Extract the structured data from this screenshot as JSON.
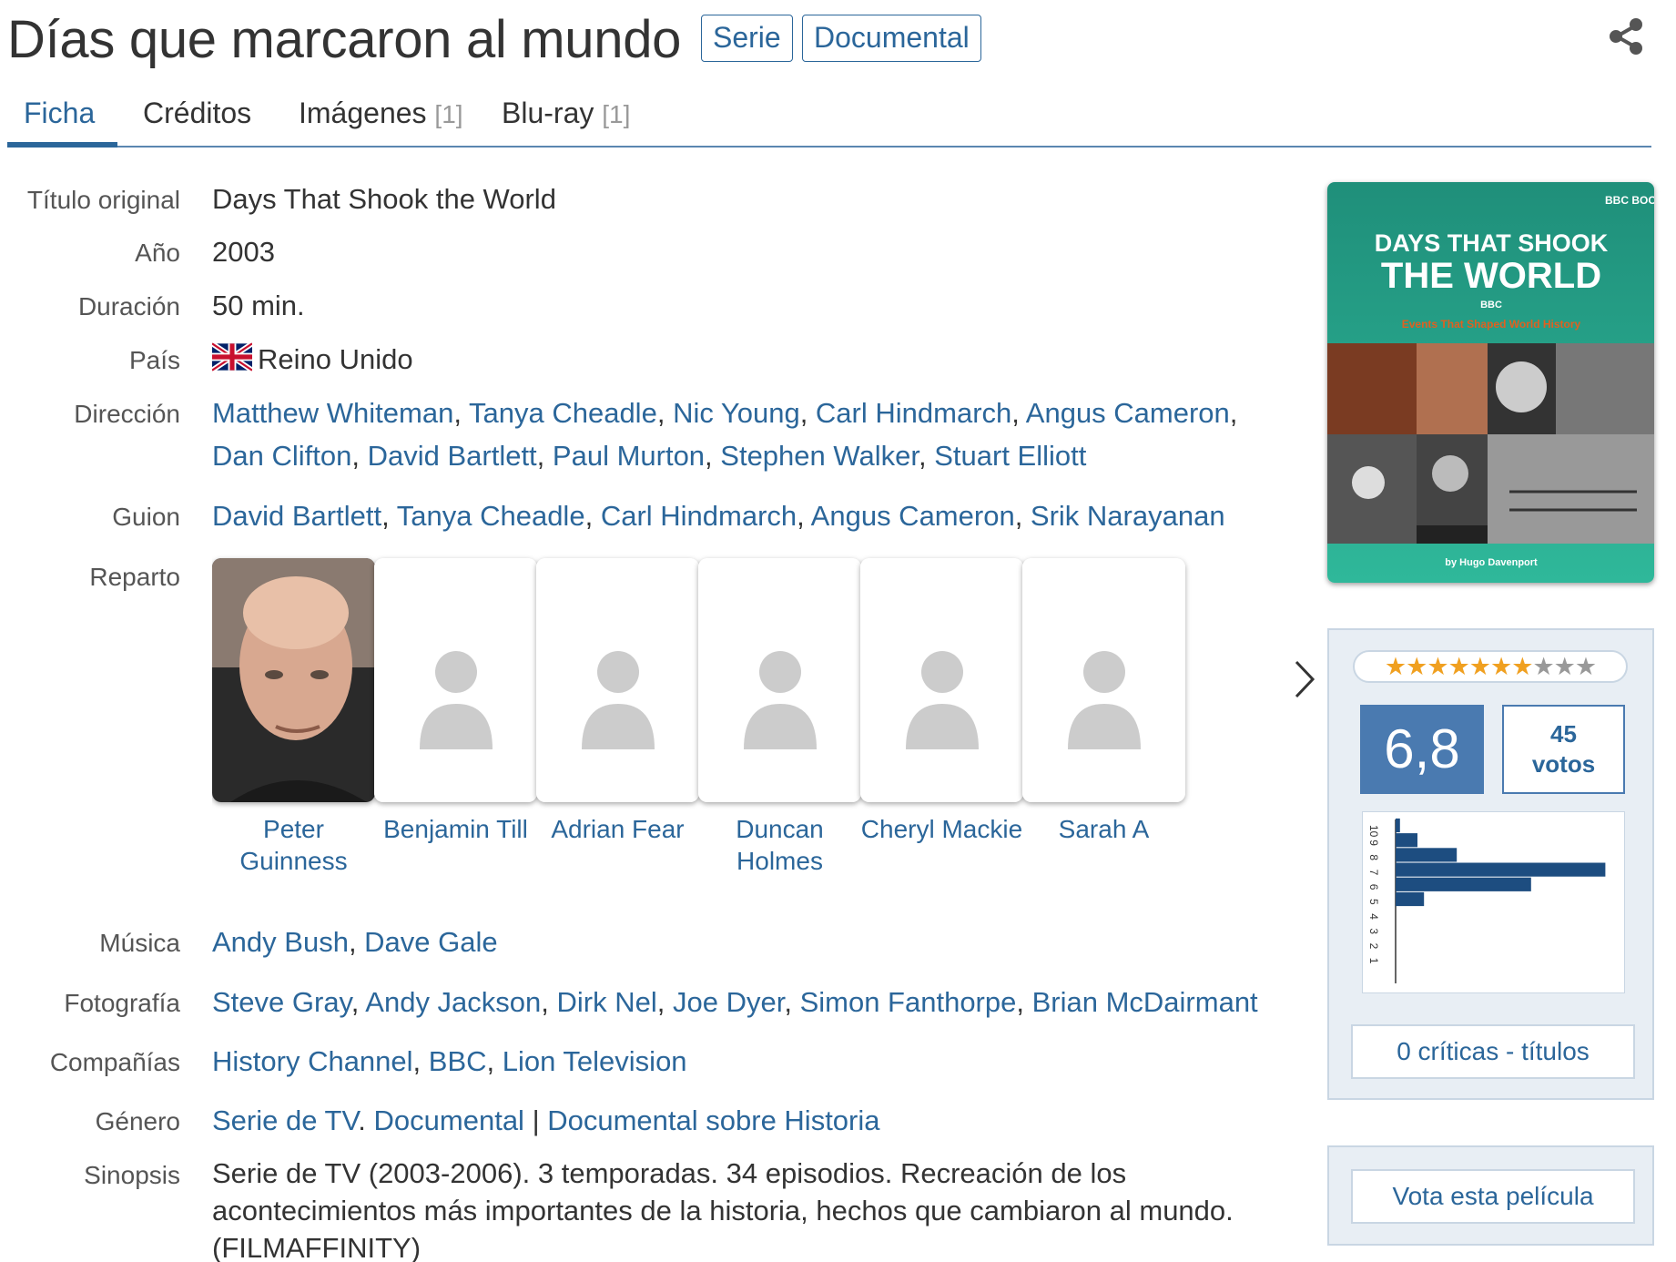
{
  "header": {
    "title": "Días que marcaron al mundo",
    "tags": [
      "Serie",
      "Documental"
    ]
  },
  "tabs": [
    {
      "label": "Ficha",
      "count": ""
    },
    {
      "label": "Créditos",
      "count": ""
    },
    {
      "label": "Imágenes",
      "count": "[1]"
    },
    {
      "label": "Blu-ray",
      "count": "[1]"
    }
  ],
  "labels": {
    "original_title": "Título original",
    "year": "Año",
    "duration": "Duración",
    "country": "País",
    "direction": "Dirección",
    "script": "Guion",
    "cast": "Reparto",
    "music": "Música",
    "photography": "Fotografía",
    "companies": "Compañías",
    "genre": "Género",
    "synopsis": "Sinopsis"
  },
  "info": {
    "original_title": "Days That Shook the World",
    "year": "2003",
    "duration": "50 min.",
    "country": "Reino Unido",
    "direction": [
      "Matthew Whiteman",
      "Tanya Cheadle",
      "Nic Young",
      "Carl Hindmarch",
      "Angus Cameron",
      "Dan Clifton",
      "David Bartlett",
      "Paul Murton",
      "Stephen Walker",
      "Stuart Elliott"
    ],
    "script": [
      "David Bartlett",
      "Tanya Cheadle",
      "Carl Hindmarch",
      "Angus Cameron",
      "Srik Narayanan"
    ],
    "music": [
      "Andy Bush",
      "Dave Gale"
    ],
    "photography": [
      "Steve Gray",
      "Andy Jackson",
      "Dirk Nel",
      "Joe Dyer",
      "Simon Fanthorpe",
      "Brian McDairmant"
    ],
    "companies": [
      "History Channel",
      "BBC",
      "Lion Television"
    ],
    "genre": [
      "Serie de TV",
      "Documental",
      "Documental sobre Historia"
    ],
    "synopsis": "Serie de TV (2003-2006). 3 temporadas. 34 episodios. Recreación de los acontecimientos más importantes de la historia, hechos que cambiaron al mundo. (FILMAFFINITY)"
  },
  "cast": [
    {
      "name": "Peter Guinness",
      "has_photo": true
    },
    {
      "name": "Benjamin Till",
      "has_photo": false
    },
    {
      "name": "Adrian Fear",
      "has_photo": false
    },
    {
      "name": "Duncan Holmes",
      "has_photo": false
    },
    {
      "name": "Cheryl Mackie",
      "has_photo": false
    },
    {
      "name": "Sarah A",
      "has_photo": false
    }
  ],
  "poster": {
    "brand": "BBC BOOKS",
    "line1": "DAYS THAT SHOOK",
    "line2": "THE WORLD",
    "bbc": "BBC",
    "subtitle": "Events That Shaped World History",
    "author": "by Hugo Davenport"
  },
  "rating": {
    "value": "6,8",
    "votes_count": "45",
    "votes_label": "votos",
    "stars_on": 7,
    "stars_total": 10,
    "criticas": "0 críticas - títulos",
    "vote_button": "Vota esta película",
    "histogram": {
      "scores": [
        10,
        9,
        8,
        7,
        6,
        5,
        4,
        3,
        2,
        1
      ],
      "share": [
        0.02,
        0.1,
        0.28,
        0.96,
        0.62,
        0.13,
        0.0,
        0.0,
        0.0,
        0.0
      ]
    }
  },
  "colors": {
    "link": "#2b669a",
    "accent": "#4a7ab0",
    "panel": "#e8eef4",
    "star": "#f0a020"
  }
}
